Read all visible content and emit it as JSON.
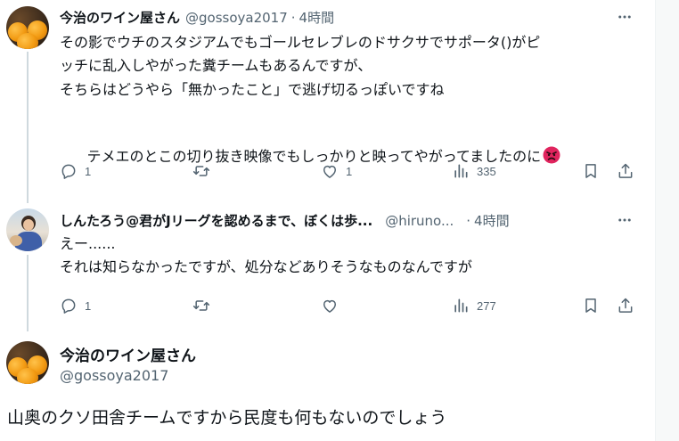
{
  "tweets": [
    {
      "name": "今治のワイン屋さん",
      "handle": "@gossoya2017",
      "separator": "·",
      "time": "4時間",
      "lines": [
        "その影でウチのスタジアムでもゴールセレブレのドサクサでサポータ()がピ",
        "ッチに乱入しやがった糞チームもあるんですが、",
        "そちらはどうやら「無かったこと」で逃げ切るっぽいですね",
        "",
        "テメエのとこの切り抜き映像でもしっかりと映ってやがってましたのに"
      ],
      "actions": {
        "replies": "1",
        "reposts": "",
        "likes": "1",
        "views": "335"
      },
      "emoji_icon": "angry-face-icon"
    },
    {
      "name": "しんたろう@君がJリーグを認めるまで、ぼくは歩...",
      "handle": "@hiruno...",
      "separator": "·",
      "time": "4時間",
      "lines": [
        "えー......",
        "それは知らなかったですが、処分などありそうなものなんですが"
      ],
      "actions": {
        "replies": "1",
        "reposts": "",
        "likes": "",
        "views": "277"
      }
    }
  ],
  "main_tweet": {
    "name": "今治のワイン屋さん",
    "handle": "@gossoya2017",
    "text": "山奥のクソ田舎チームですから民度も何もないのでしょう"
  },
  "colors": {
    "text": "#0f1419",
    "secondary": "#536471",
    "thread_line": "#cfd9de",
    "emoji": "#e0245e"
  },
  "icons": [
    "reply-icon",
    "repost-icon",
    "like-icon",
    "views-icon",
    "bookmark-icon",
    "share-icon",
    "more-icon"
  ]
}
